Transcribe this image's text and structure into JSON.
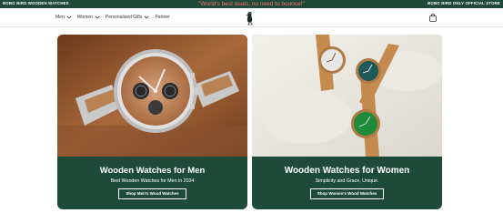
{
  "topbar": {
    "left_text": "BOBO BIRD WOODEN WATCHES",
    "promo": "\"World's best deals, no need to bounce!\"",
    "right_text": "BOBO BIRD ONLY OFFICIAL STORE"
  },
  "nav": {
    "items": [
      {
        "label": "Men",
        "has_dropdown": true
      },
      {
        "label": "Women",
        "has_dropdown": true
      },
      {
        "label": "Personalized Gifts",
        "has_dropdown": true
      },
      {
        "label": "Partner",
        "has_dropdown": false
      }
    ],
    "logo_icon": "bird-logo-icon",
    "cart_icon": "shopping-bag-icon"
  },
  "cards": {
    "men": {
      "title": "Wooden Watches for Men",
      "subtitle": "Best Wooden Watches for Men in 2024",
      "button": "Shop Men's Wood Watches"
    },
    "women": {
      "title": "Wooden Watches for Women",
      "subtitle": "Simplicity and Grace, Unique.",
      "button": "Shop Women's Wood Watches"
    }
  },
  "colors": {
    "brand_green": "#1e4a3a",
    "promo_red": "#ff6f6f"
  }
}
